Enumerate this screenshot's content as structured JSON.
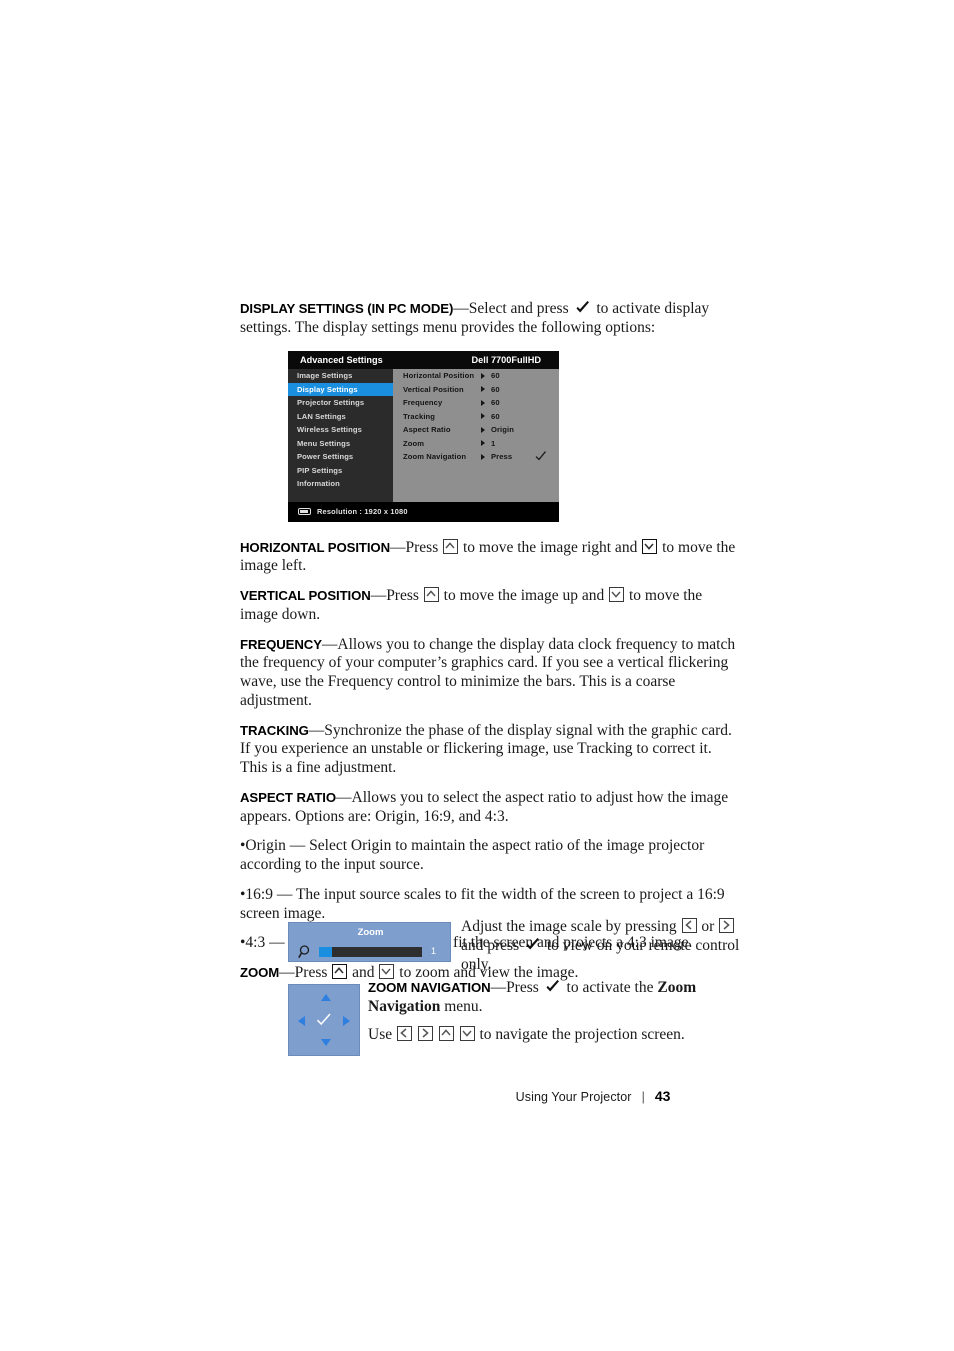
{
  "page": {
    "footer_label": "Using Your Projector",
    "footer_separator": "|",
    "page_number": "43"
  },
  "sections": {
    "display_settings": {
      "term": "Display Settings (in PC Mode)",
      "text_1": "—Select and press",
      "text_2": "to activate display settings. The display settings menu provides the following options:"
    },
    "horizontal_position": {
      "term": "Horizontal Position",
      "text_1": "—Press",
      "text_2": "to move the image right and",
      "text_3": "to move the image left."
    },
    "vertical_position": {
      "term": "Vertical Position",
      "text_1": "—Press",
      "text_2": "to move the image up and",
      "text_3": "to move the image down."
    },
    "frequency": {
      "term": "Frequency",
      "text": "—Allows you to change the display data clock frequency to match the frequency of your computer’s graphics card. If you see a vertical flickering wave, use the Frequency control to minimize the bars. This is a coarse adjustment."
    },
    "tracking": {
      "term": "Tracking",
      "text": "—Synchronize the phase of the display signal with the graphic card. If you experience an unstable or flickering image, use Tracking to correct it. This is a fine adjustment."
    },
    "aspect_ratio": {
      "term": "Aspect Ratio",
      "text": "—Allows you to select the aspect ratio to adjust how the image appears. Options are: Origin, 16:9, and 4:3.",
      "bullets": [
        "•Origin — Select Origin to maintain the aspect ratio of the image projector according to the input source.",
        "•16:9 — The input source scales to fit the width of the screen to project a 16:9 screen image.",
        "•4:3 — The input source scales to fit the screen and projects a 4:3 image."
      ]
    },
    "zoom": {
      "term": "Zoom",
      "text_1": "—Press",
      "text_2": "and",
      "text_3": "to zoom and view the image.",
      "side_text_1": "Adjust the image scale by pressing",
      "side_text_or": "or",
      "side_text_2": "and press",
      "side_text_3": "to view on your remote control only."
    },
    "zoom_navigation": {
      "term": "Zoom Navigation",
      "text_1": "—Press",
      "text_2": "to activate the",
      "bold_phrase": "Zoom Navigation",
      "text_3": "menu.",
      "text_4": "Use",
      "text_5": "to navigate the projection screen."
    }
  },
  "osd": {
    "title": "Advanced Settings",
    "model": "Dell 7700FullHD",
    "menu_items": [
      {
        "label": "Image Settings",
        "selected": false
      },
      {
        "label": "Display Settings",
        "selected": true
      },
      {
        "label": "Projector Settings",
        "selected": false
      },
      {
        "label": "LAN Settings",
        "selected": false
      },
      {
        "label": "Wireless Settings",
        "selected": false
      },
      {
        "label": "Menu Settings",
        "selected": false
      },
      {
        "label": "Power Settings",
        "selected": false
      },
      {
        "label": "PIP Settings",
        "selected": false
      },
      {
        "label": "Information",
        "selected": false
      }
    ],
    "rows": [
      {
        "label": "Horizontal Position",
        "value": "60",
        "tick": false
      },
      {
        "label": "Vertical Position",
        "value": "60",
        "tick": false
      },
      {
        "label": "Frequency",
        "value": "60",
        "tick": false
      },
      {
        "label": "Tracking",
        "value": "60",
        "tick": false
      },
      {
        "label": "Aspect Ratio",
        "value": "Origin",
        "tick": false
      },
      {
        "label": "Zoom",
        "value": "1",
        "tick": false
      },
      {
        "label": "Zoom Navigation",
        "value": "Press",
        "tick": true
      }
    ],
    "status": "Resolution  :   1920   x   1080",
    "colors": {
      "highlight": "#1a8fe0",
      "left_panel": "#2b2b2b",
      "right_panel": "#8f8f8f",
      "title_bar": "#0a0a0a"
    }
  },
  "zoom_widget": {
    "title": "Zoom",
    "value": "1",
    "background": "#7e9fcd",
    "fill_color": "#1a8fe0"
  },
  "nav_widget": {
    "background": "#7e9fcd",
    "arrow_color": "#2f7fe0"
  }
}
